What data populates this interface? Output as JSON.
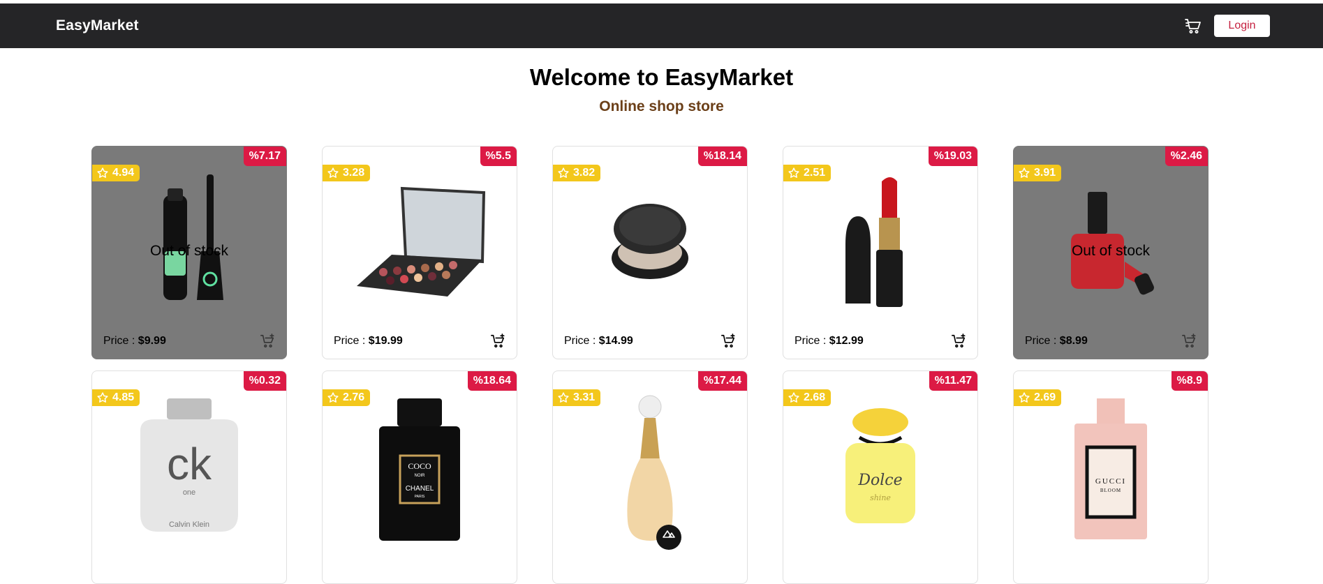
{
  "app": {
    "brand": "EasyMarket",
    "login_label": "Login"
  },
  "hero": {
    "title": "Welcome to EasyMarket",
    "subtitle": "Online shop store"
  },
  "colors": {
    "navbar": "#252527",
    "discount": "#dc1a45",
    "rating": "#f3c71b",
    "subtitle": "#6b3f18",
    "out_of_stock_bg": "#7a7a7a"
  },
  "price_label": "Price :",
  "out_of_stock_label": "Out of stock",
  "products": [
    {
      "discount": "%7.17",
      "rating": "4.94",
      "price": "$9.99",
      "out_of_stock": true,
      "image": "mascara-icon"
    },
    {
      "discount": "%5.5",
      "rating": "3.28",
      "price": "$19.99",
      "out_of_stock": false,
      "image": "eyeshadow-palette-icon"
    },
    {
      "discount": "%18.14",
      "rating": "3.82",
      "price": "$14.99",
      "out_of_stock": false,
      "image": "powder-compact-icon"
    },
    {
      "discount": "%19.03",
      "rating": "2.51",
      "price": "$12.99",
      "out_of_stock": false,
      "image": "lipstick-icon"
    },
    {
      "discount": "%2.46",
      "rating": "3.91",
      "price": "$8.99",
      "out_of_stock": true,
      "image": "nail-polish-icon"
    },
    {
      "discount": "%0.32",
      "rating": "4.85",
      "price": "",
      "out_of_stock": false,
      "image": "ck-one-bottle-icon",
      "image_text": [
        "ck",
        "one",
        "Calvin Klein"
      ]
    },
    {
      "discount": "%18.64",
      "rating": "2.76",
      "price": "",
      "out_of_stock": false,
      "image": "coco-noir-bottle-icon",
      "image_text": [
        "COCO",
        "NOIR",
        "CHANEL",
        "PARIS"
      ]
    },
    {
      "discount": "%17.44",
      "rating": "3.31",
      "price": "",
      "out_of_stock": false,
      "image": "jadore-bottle-icon"
    },
    {
      "discount": "%11.47",
      "rating": "2.68",
      "price": "",
      "out_of_stock": false,
      "image": "dolce-shine-bottle-icon",
      "image_text": [
        "Dolce",
        "shine"
      ]
    },
    {
      "discount": "%8.9",
      "rating": "2.69",
      "price": "",
      "out_of_stock": false,
      "image": "gucci-bloom-bottle-icon",
      "image_text": [
        "GUCCI",
        "BLOOM"
      ]
    }
  ]
}
